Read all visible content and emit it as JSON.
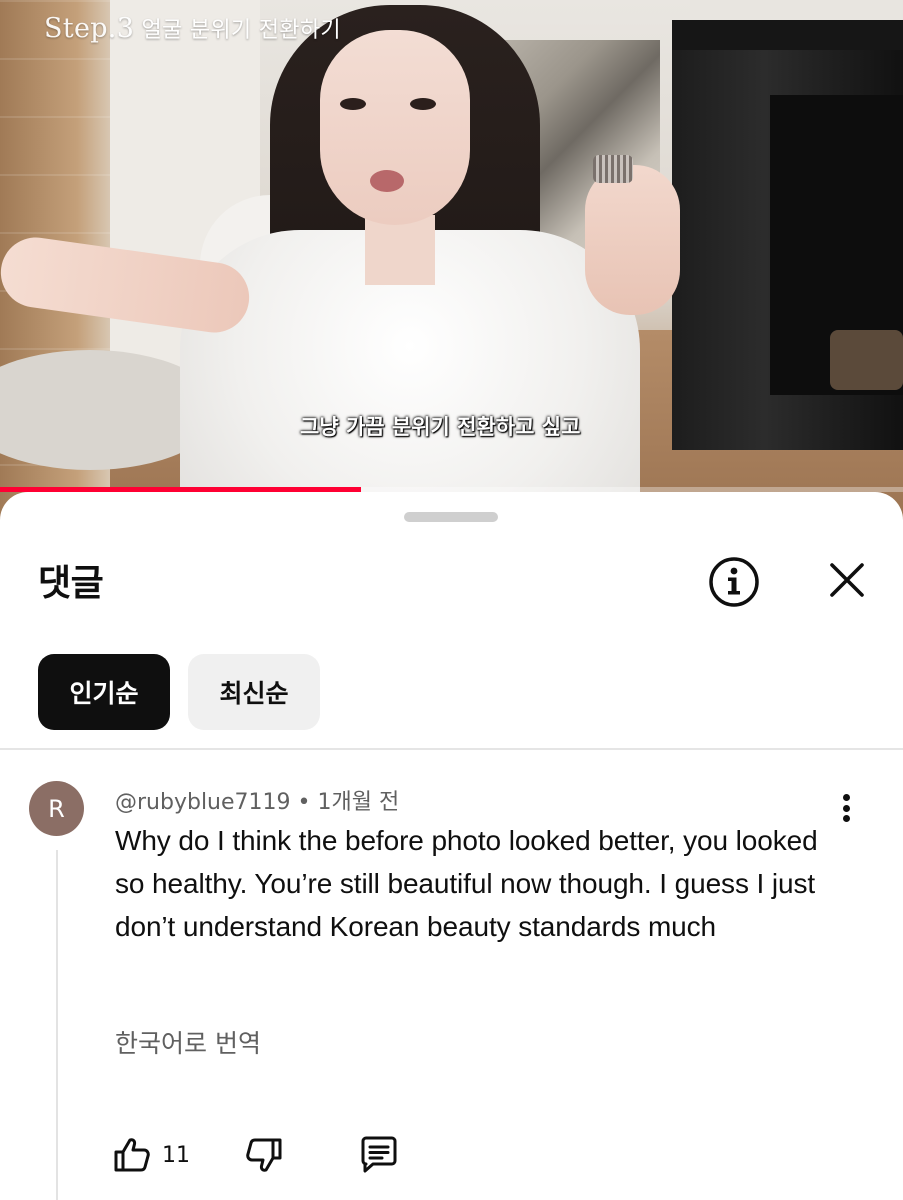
{
  "video": {
    "title_step": "Step.3",
    "title_text": "얼굴 분위기 전환하기",
    "caption": "그냥 가끔 분위기 전환하고 싶고",
    "progress": 0.4
  },
  "comments_panel": {
    "title": "댓글",
    "info_icon": "info-icon",
    "close_icon": "close-icon",
    "sort_chips": [
      {
        "label": "인기순",
        "active": true
      },
      {
        "label": "최신순",
        "active": false
      }
    ]
  },
  "comment": {
    "avatar_letter": "R",
    "avatar_color": "#8b6e65",
    "author": "@rubyblue7119",
    "separator": "•",
    "time": "1개월 전",
    "text": "Why do I think the before photo looked better, you looked so healthy. You’re still beautiful now though. I guess I just don’t understand Korean beauty standards much",
    "translate_label": "한국어로 번역",
    "like_count": "11",
    "icons": [
      "thumbs-up-icon",
      "thumbs-down-icon",
      "reply-icon",
      "more-vertical-icon"
    ]
  },
  "colors": {
    "accent": "#ff0033",
    "chip_active_bg": "#0f0f0f",
    "chip_inactive_bg": "#f0f0f0",
    "secondary_text": "#606060"
  }
}
